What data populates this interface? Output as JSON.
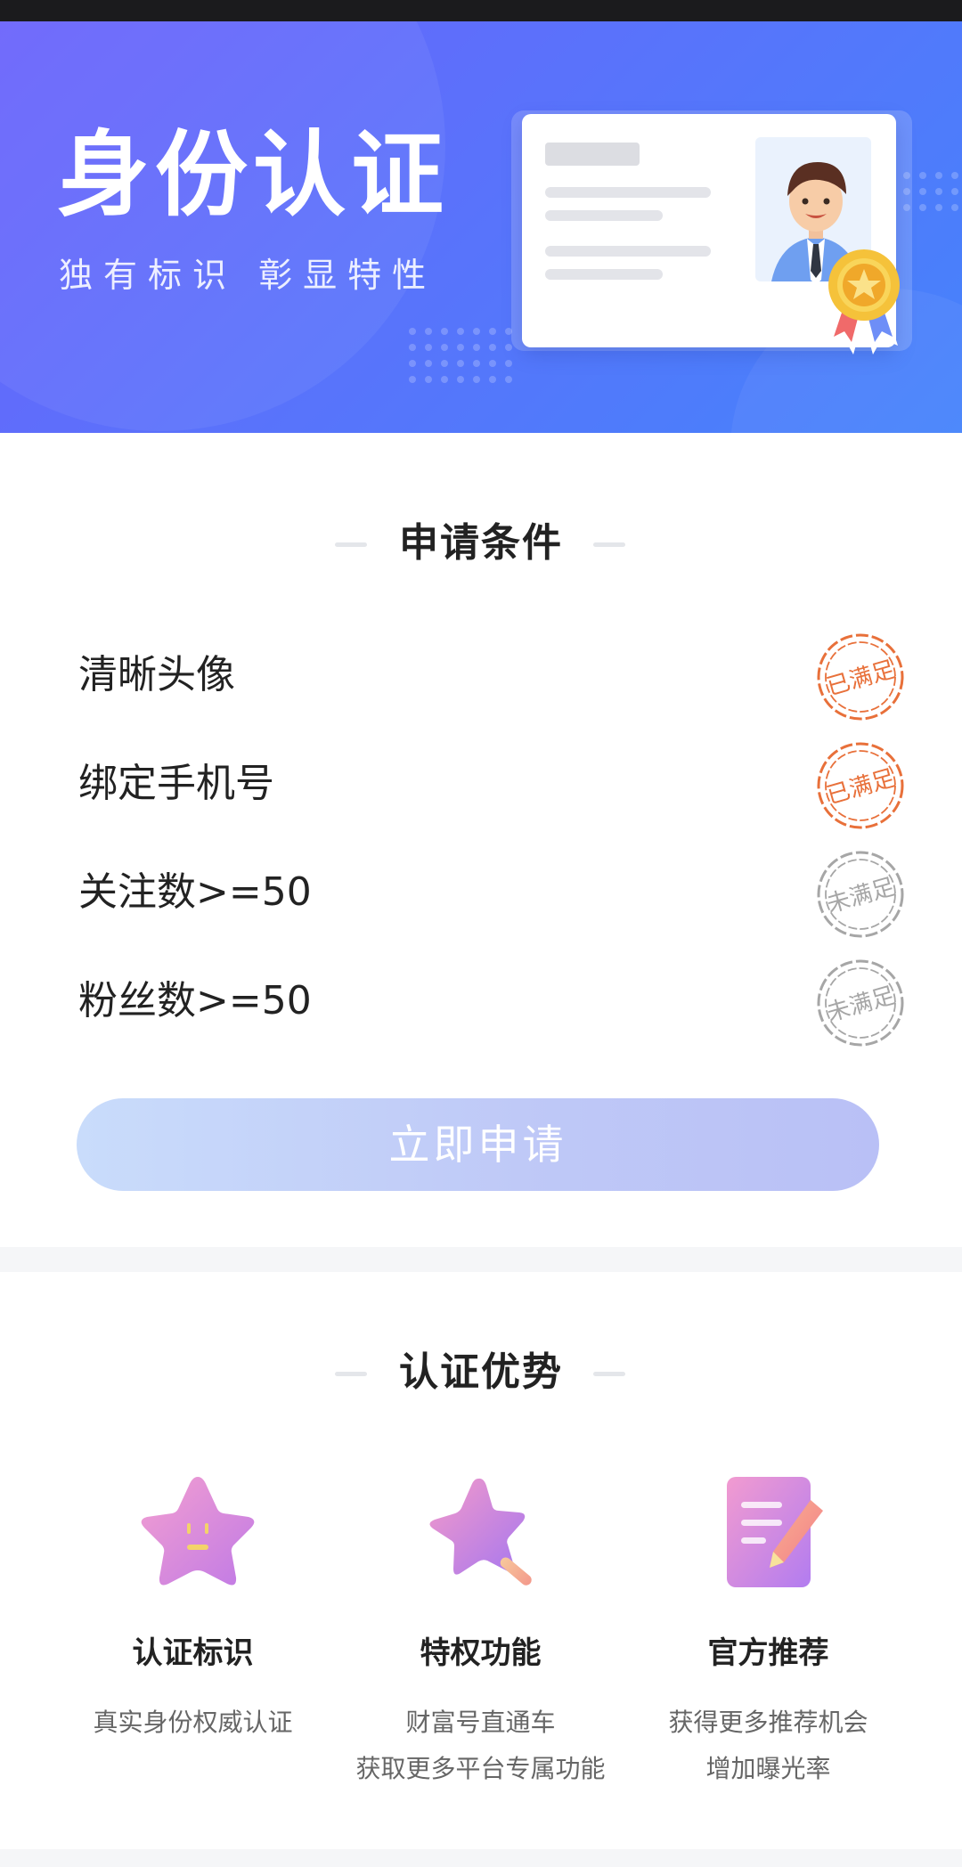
{
  "banner": {
    "title": "身份认证",
    "subtitle": "独有标识 彰显特性"
  },
  "conditions": {
    "title": "申请条件",
    "items": [
      {
        "label": "清晰头像",
        "status": "已满足",
        "met": true
      },
      {
        "label": "绑定手机号",
        "status": "已满足",
        "met": true
      },
      {
        "label": "关注数>=50",
        "status": "未满足",
        "met": false
      },
      {
        "label": "粉丝数>=50",
        "status": "未满足",
        "met": false
      }
    ],
    "apply_label": "立即申请"
  },
  "advantages": {
    "title": "认证优势",
    "items": [
      {
        "title": "认证标识",
        "desc1": "真实身份权威认证",
        "desc2": "",
        "icon": "star-face-icon"
      },
      {
        "title": "特权功能",
        "desc1": "财富号直通车",
        "desc2": "获取更多平台专属功能",
        "icon": "magic-star-icon"
      },
      {
        "title": "官方推荐",
        "desc1": "获得更多推荐机会",
        "desc2": "增加曝光率",
        "icon": "document-pencil-icon"
      }
    ]
  },
  "colors": {
    "banner_start": "#6a62fb",
    "banner_end": "#4583fb",
    "stamp_met": "#e8703a",
    "stamp_unmet": "#a6a6a6",
    "apply_button": "#c3d0f8"
  }
}
